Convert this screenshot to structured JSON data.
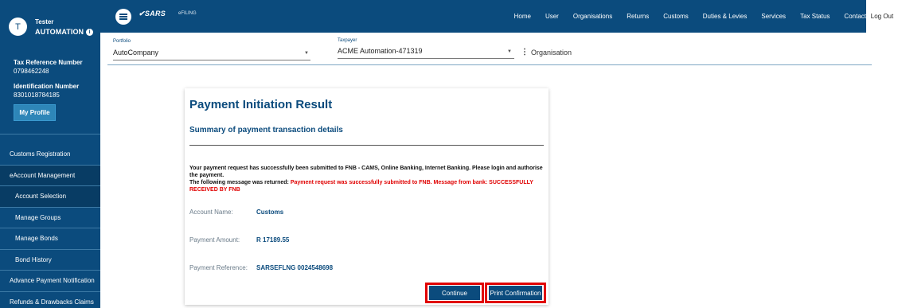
{
  "sidebar": {
    "avatar_initial": "T",
    "user_first": "Tester",
    "user_last": "AUTOMATION",
    "tax_ref_label": "Tax Reference Number",
    "tax_ref_value": "0798462248",
    "id_label": "Identification Number",
    "id_value": "8301018784185",
    "profile_button": "My Profile",
    "menu": [
      {
        "label": "Customs Registration",
        "sub": false,
        "dark": false
      },
      {
        "label": "eAccount Management",
        "sub": false,
        "dark": true
      },
      {
        "label": "Account Selection",
        "sub": true,
        "dark": true
      },
      {
        "label": "Manage Groups",
        "sub": true,
        "dark": false
      },
      {
        "label": "Manage Bonds",
        "sub": true,
        "dark": false
      },
      {
        "label": "Bond History",
        "sub": true,
        "dark": false
      },
      {
        "label": "Advance Payment Notification",
        "sub": false,
        "dark": false
      },
      {
        "label": "Refunds & Drawbacks Claims",
        "sub": false,
        "dark": false
      }
    ]
  },
  "topbar": {
    "logo_text": "SARS",
    "logo_sub": "eFILING",
    "nav": [
      "Home",
      "User",
      "Organisations",
      "Returns",
      "Customs",
      "Duties & Levies",
      "Services",
      "Tax Status",
      "Contact"
    ],
    "logout": "Log Out"
  },
  "selectors": {
    "portfolio_label": "Portfolio",
    "portfolio_value": "AutoCompany",
    "taxpayer_label": "Taxpayer",
    "taxpayer_value": "ACME Automation-471319",
    "organisation_label": "Organisation"
  },
  "card": {
    "title": "Payment Initiation Result",
    "subtitle": "Summary of payment transaction details",
    "message_part1": "Your payment request has successfully been submitted to FNB - CAMS, Online Banking, Internet Banking. Please login and authorise the payment.",
    "message_part2": "The following message was returned: ",
    "message_red": "Payment request was successfully submitted to FNB. Message from bank: SUCCESSFULLY RECEIVED BY FNB",
    "details": [
      {
        "label": "Account Name:",
        "value": "Customs"
      },
      {
        "label": "Payment Amount:",
        "value": "R 17189.55"
      },
      {
        "label": "Payment Reference:",
        "value": "SARSEFLNG 0024548698"
      }
    ],
    "continue_button": "Continue",
    "print_button": "Print Confirmation"
  },
  "colors": {
    "brand_blue": "#0b4b7d",
    "highlight_red": "#e10000",
    "message_red": "#e00000"
  }
}
